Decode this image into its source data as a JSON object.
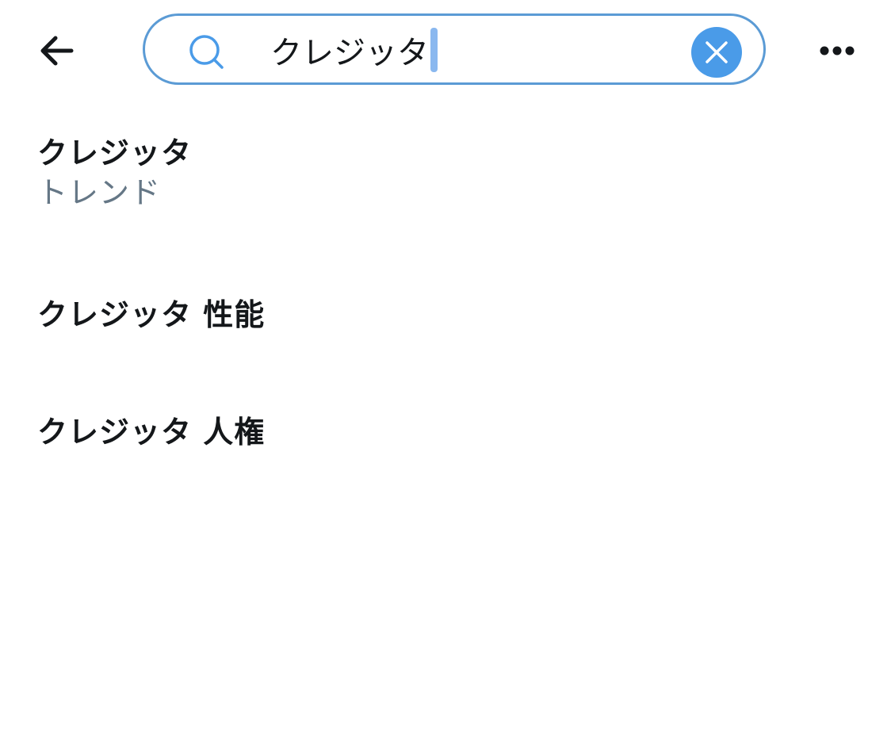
{
  "header": {
    "back_icon": "arrow-left-icon",
    "more_icon": "ellipsis-horizontal-icon"
  },
  "search": {
    "value": "クレジッタ",
    "icon": "search-icon",
    "clear_icon": "close-icon",
    "border_color": "#5b9bd5",
    "clear_color": "#4a9be8",
    "caret_color": "#8ab8ef"
  },
  "suggestions": [
    {
      "title": "クレジッタ",
      "subtitle": "トレンド"
    },
    {
      "title": "クレジッタ 性能"
    },
    {
      "title": "クレジッタ 人権"
    }
  ]
}
